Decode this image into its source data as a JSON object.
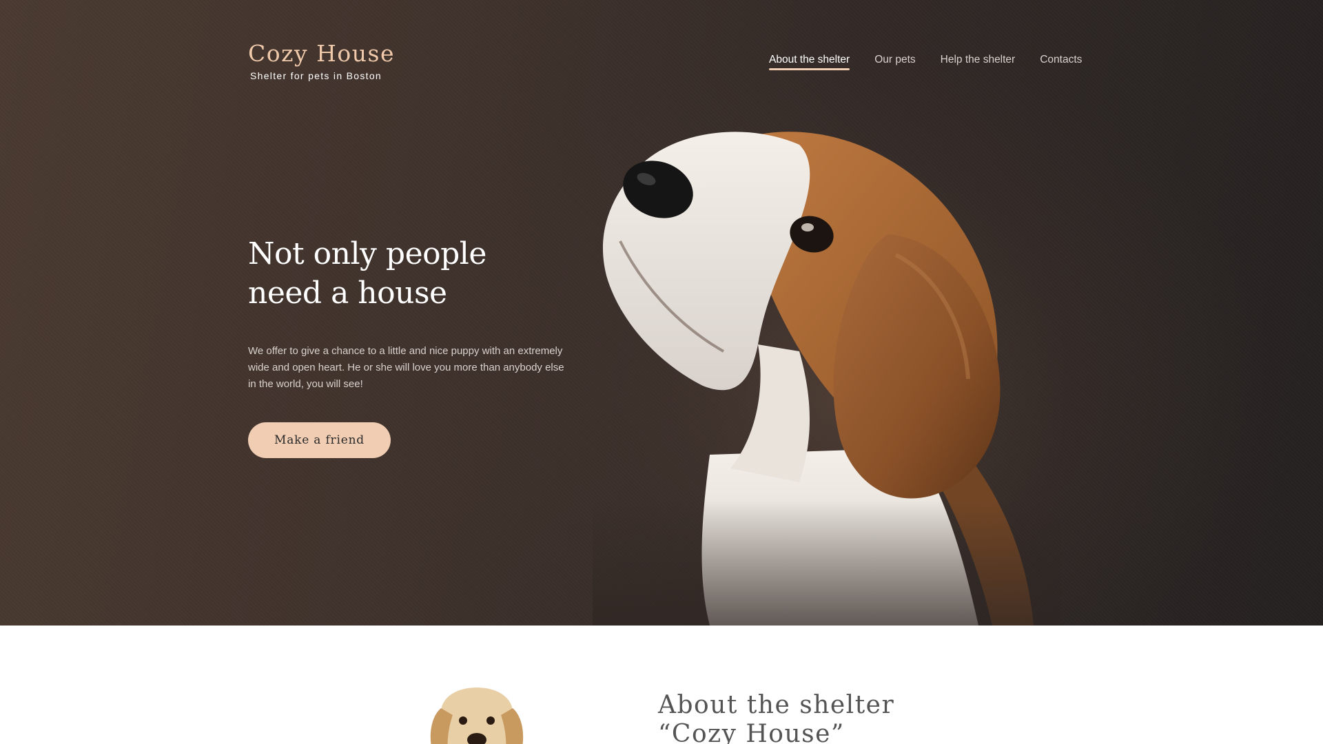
{
  "header": {
    "logo_title": "Cozy House",
    "logo_subtitle": "Shelter for pets in Boston",
    "nav": [
      {
        "label": "About the shelter",
        "active": true
      },
      {
        "label": "Our pets",
        "active": false
      },
      {
        "label": "Help the shelter",
        "active": false
      },
      {
        "label": "Contacts",
        "active": false
      }
    ]
  },
  "hero": {
    "headline_line1": "Not only people",
    "headline_line2": "need a house",
    "lead": "We offer to give a chance to a little and nice puppy with an extremely wide and open heart. He or she will love you more than anybody else in the world, you will see!",
    "cta_label": "Make a friend"
  },
  "about": {
    "title_line1": "About the shelter",
    "title_line2": "“Cozy House”"
  },
  "colors": {
    "accent": "#f1cdb3",
    "logo": "#f0c9aa",
    "hero_bg": "#3f322c",
    "about_title": "#545454"
  },
  "icons": {
    "hero_image": "beagle-puppy-image",
    "about_image": "golden-puppy-image"
  }
}
